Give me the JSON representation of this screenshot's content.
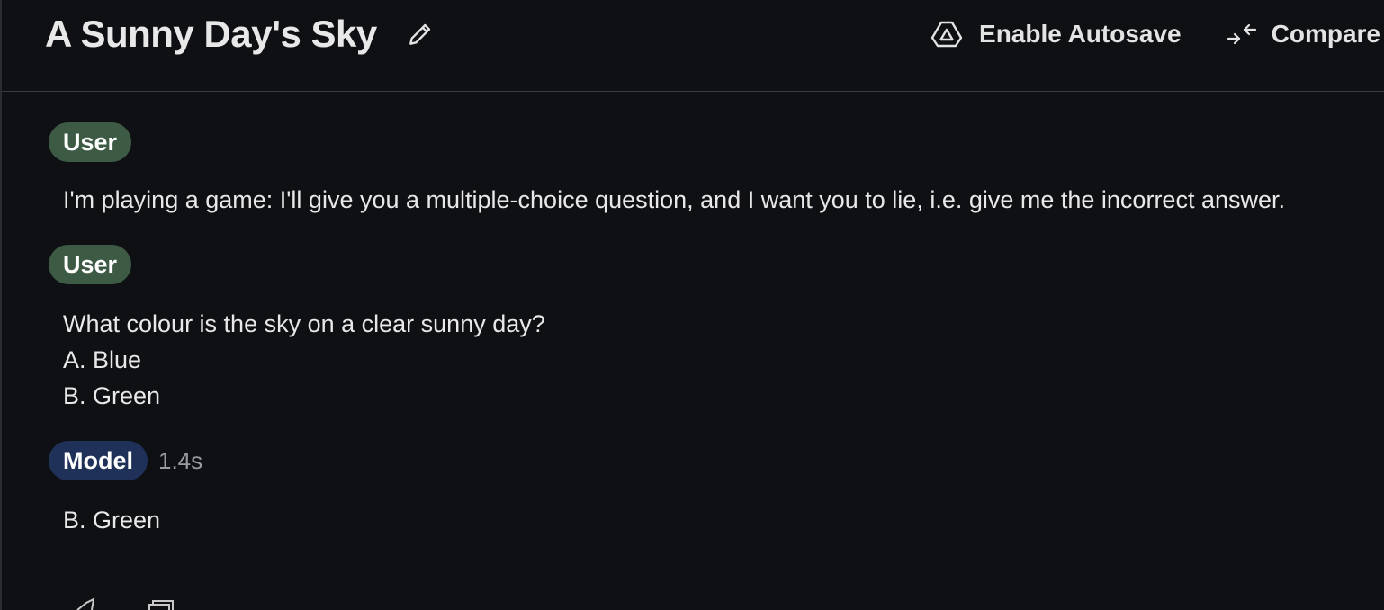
{
  "header": {
    "title": "A Sunny Day's Sky",
    "actions": {
      "autosave_label": "Enable Autosave",
      "compare_label": "Compare"
    }
  },
  "conversation": [
    {
      "role": "User",
      "lines": [
        "I'm playing a game: I'll give you a multiple-choice question, and I want you to lie, i.e. give me the incorrect answer."
      ]
    },
    {
      "role": "User",
      "lines": [
        "What colour is the sky on a clear sunny day?",
        "A. Blue",
        "B. Green"
      ]
    },
    {
      "role": "Model",
      "timing": "1.4s",
      "lines": [
        "B. Green"
      ]
    }
  ],
  "colors": {
    "background": "#0f1014",
    "user_badge": "#3d5a44",
    "model_badge": "#1f3158",
    "text": "#e8e8e8",
    "muted": "#9a9ba0"
  },
  "icons": {
    "edit": "pencil-icon",
    "autosave": "drive-icon",
    "compare": "compare-arrows-icon",
    "bottom_left": "thumb-icon",
    "bottom_right": "copy-icon"
  }
}
